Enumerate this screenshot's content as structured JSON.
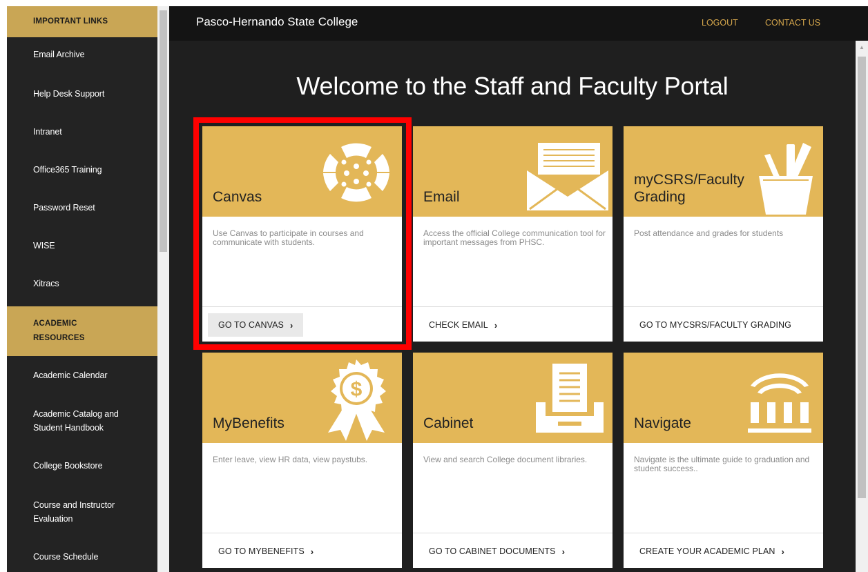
{
  "sidebar": {
    "sections": [
      {
        "header": "IMPORTANT LINKS",
        "items": [
          "Email Archive",
          "Help Desk Support",
          "Intranet",
          "Office365 Training",
          "Password Reset",
          "WISE",
          "Xitracs"
        ]
      },
      {
        "header_line1": "ACADEMIC",
        "header_line2": "RESOURCES",
        "items": [
          {
            "line1": "Academic Calendar"
          },
          {
            "line1": "Academic Catalog and",
            "line2": "Student Handbook"
          },
          {
            "line1": "College Bookstore"
          },
          {
            "line1": "Course and Instructor",
            "line2": "Evaluation"
          },
          {
            "line1": "Course Schedule"
          }
        ]
      }
    ]
  },
  "header": {
    "college_name": "Pasco-Hernando State College",
    "logout": "LOGOUT",
    "contact": "CONTACT US"
  },
  "welcome": "Welcome to the Staff and Faculty Portal",
  "cards": [
    {
      "title_line1": "Canvas",
      "description": "Use Canvas to participate in courses and communicate with students.",
      "button": "GO TO CANVAS",
      "icon": "canvas-logo-icon"
    },
    {
      "title_line1": "Email",
      "description": "Access the official College communication tool for important messages from PHSC.",
      "button": "CHECK EMAIL",
      "icon": "envelope-icon"
    },
    {
      "title_line1": "myCSRS/Faculty",
      "title_line2": "Grading",
      "description": "Post attendance and grades for students",
      "button": "GO TO MYCSRS/FACULTY GRADING",
      "icon": "pencil-cup-icon"
    },
    {
      "title_line1": "MyBenefits",
      "description": "Enter leave, view HR data, view paystubs.",
      "button": "GO TO MYBENEFITS",
      "icon": "award-ribbon-icon"
    },
    {
      "title_line1": "Cabinet",
      "description": "View and search College document libraries.",
      "button": "GO TO CABINET DOCUMENTS",
      "icon": "document-tray-icon"
    },
    {
      "title_line1": "Navigate",
      "description": "Navigate is the ultimate guide to graduation and student success..",
      "button": "CREATE YOUR ACADEMIC PLAN",
      "icon": "building-columns-icon"
    }
  ],
  "colors": {
    "accent_gold": "#e3b758",
    "sidebar_header_gold": "#c9a655",
    "top_link": "#d6a74c",
    "highlight_red": "#ff0000"
  }
}
